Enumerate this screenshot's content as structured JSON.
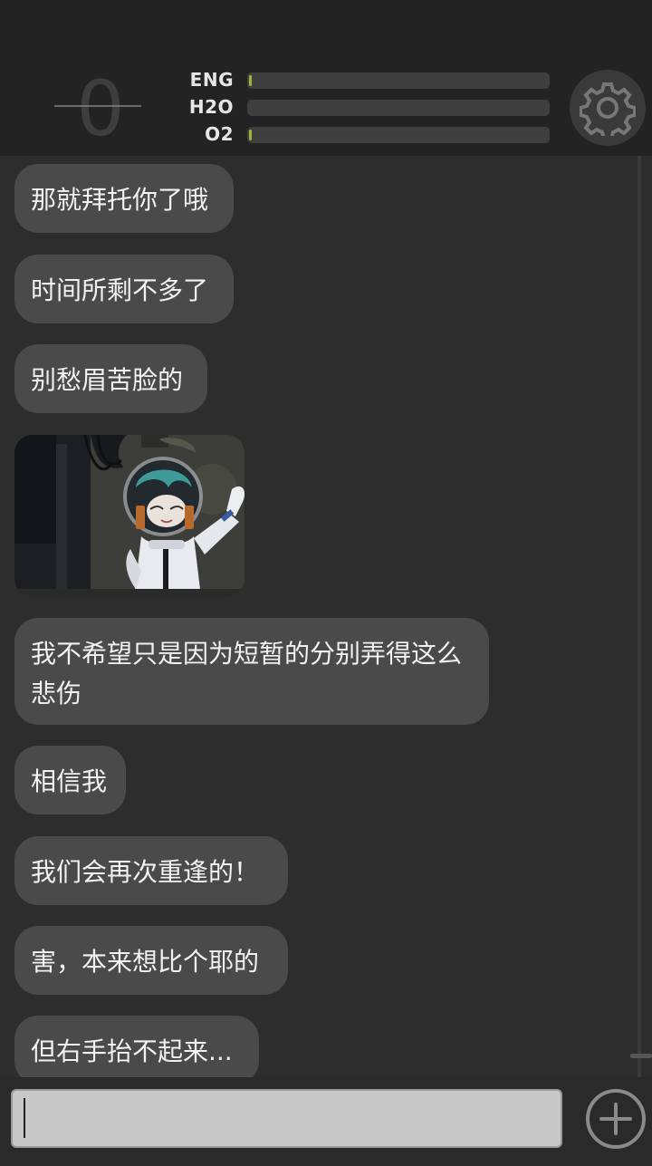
{
  "header": {
    "counter": "0",
    "stats": [
      {
        "label": "ENG",
        "level": 0.01,
        "color": "#a5b23a"
      },
      {
        "label": "H2O",
        "level": 0.0
      },
      {
        "label": "O2",
        "level": 0.01,
        "color": "#a5b23a"
      }
    ],
    "settings_icon": "gear-icon"
  },
  "chat": {
    "messages": [
      "那就拜托你了哦",
      "时间所剩不多了",
      "别愁眉苦脸的",
      "我不希望只是因为短暂的分别弄得这么悲伤",
      "相信我",
      "我们会再次重逢的！",
      "害，本来想比个耶的",
      "但右手抬不起来..."
    ],
    "image": "astronaut-photo"
  },
  "input": {
    "value": "",
    "placeholder": ""
  },
  "add_icon": "plus-circle-icon"
}
